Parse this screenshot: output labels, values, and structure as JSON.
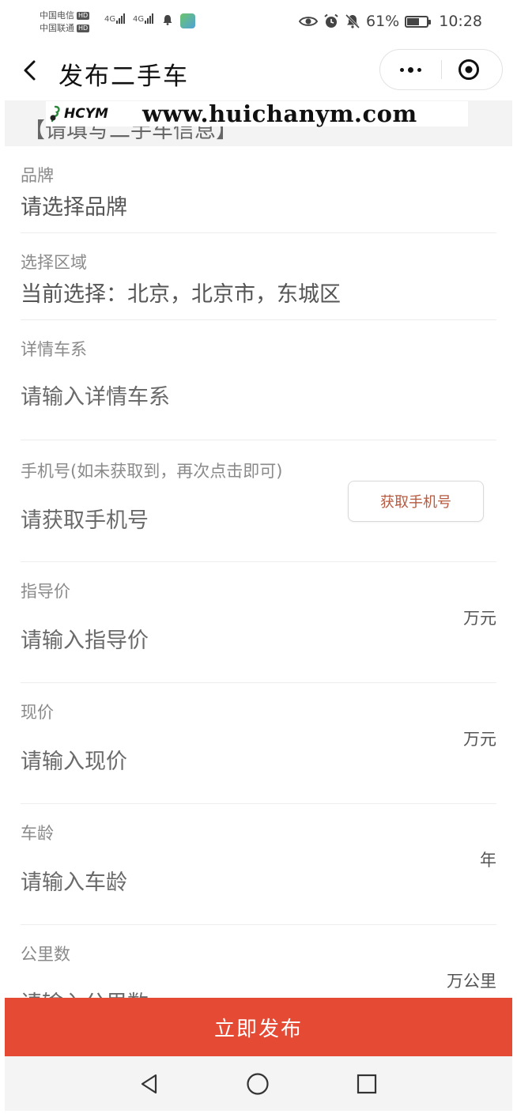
{
  "status_bar": {
    "carrier_1": "中国电信",
    "carrier_2": "中国联通",
    "hd_1": "HD",
    "hd_2": "HD",
    "net_1": "4G",
    "net_2": "4G",
    "battery_percent": "61%",
    "battery_level": 0.61,
    "time": "10:28",
    "icons": [
      "eye-icon",
      "alarm-icon",
      "mute-icon",
      "battery-icon"
    ]
  },
  "nav": {
    "title": "发布二手车",
    "back_icon": "back-chevron-icon",
    "more_icon": "more-dots-icon",
    "close_icon": "target-close-icon"
  },
  "section": {
    "header": "【请填写二手车信息】"
  },
  "watermark": {
    "logo_text": "HCYM",
    "url": "www.huichanym.com"
  },
  "form": {
    "brand": {
      "label": "品牌",
      "value": "请选择品牌"
    },
    "region": {
      "label": "选择区域",
      "value": "当前选择：北京，北京市，东城区"
    },
    "series": {
      "label": "详情车系",
      "placeholder": "请输入详情车系"
    },
    "phone": {
      "label": "手机号(如未获取到，再次点击即可)",
      "placeholder": "请获取手机号",
      "button": "获取手机号"
    },
    "guide_price": {
      "label": "指导价",
      "placeholder": "请输入指导价",
      "unit": "万元"
    },
    "current_price": {
      "label": "现价",
      "placeholder": "请输入现价",
      "unit": "万元"
    },
    "car_age": {
      "label": "车龄",
      "placeholder": "请输入车龄",
      "unit": "年"
    },
    "mileage": {
      "label": "公里数",
      "placeholder": "请输入公里数",
      "unit": "万公里"
    }
  },
  "actions": {
    "publish": "立即发布"
  },
  "system_nav": [
    "back-triangle-icon",
    "home-circle-icon",
    "recents-square-icon"
  ],
  "colors": {
    "accent": "#e54a35",
    "button_text": "#b65a40"
  }
}
